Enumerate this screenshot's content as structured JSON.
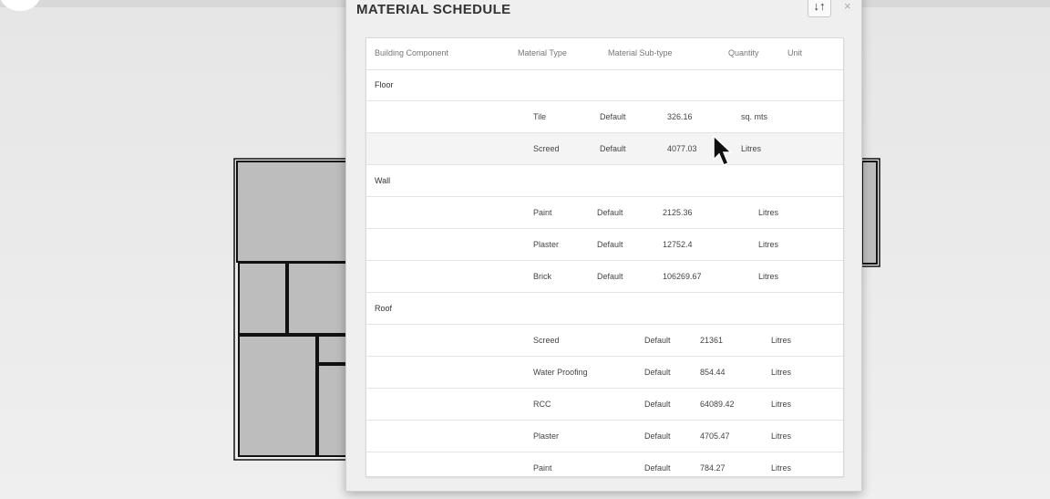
{
  "modal": {
    "title": "MATERIAL SCHEDULE",
    "sort_icon": "sort-icon",
    "close_icon": "close-icon",
    "close_glyph": "×",
    "sort_glyph": "↓↑"
  },
  "table": {
    "headers": [
      "Building Component",
      "Material Type",
      "Material Sub-type",
      "Quantity",
      "Unit"
    ],
    "groups": [
      {
        "component": "Floor",
        "rows": [
          {
            "type": "Tile",
            "subtype": "Default",
            "quantity": "326.16",
            "unit": "sq. mts"
          },
          {
            "type": "Screed",
            "subtype": "Default",
            "quantity": "4077.03",
            "unit": "Litres"
          }
        ]
      },
      {
        "component": "Wall",
        "rows": [
          {
            "type": "Paint",
            "subtype": "Default",
            "quantity": "2125.36",
            "unit": "Litres"
          },
          {
            "type": "Plaster",
            "subtype": "Default",
            "quantity": "12752.4",
            "unit": "Litres"
          },
          {
            "type": "Brick",
            "subtype": "Default",
            "quantity": "106269.67",
            "unit": "Litres"
          }
        ]
      },
      {
        "component": "Roof",
        "rows": [
          {
            "type": "Screed",
            "subtype": "Default",
            "quantity": "21361",
            "unit": "Litres"
          },
          {
            "type": "Water Proofing",
            "subtype": "Default",
            "quantity": "854.44",
            "unit": "Litres"
          },
          {
            "type": "RCC",
            "subtype": "Default",
            "quantity": "64089.42",
            "unit": "Litres"
          },
          {
            "type": "Plaster",
            "subtype": "Default",
            "quantity": "4705.47",
            "unit": "Litres"
          },
          {
            "type": "Paint",
            "subtype": "Default",
            "quantity": "784.27",
            "unit": "Litres"
          }
        ]
      }
    ]
  }
}
